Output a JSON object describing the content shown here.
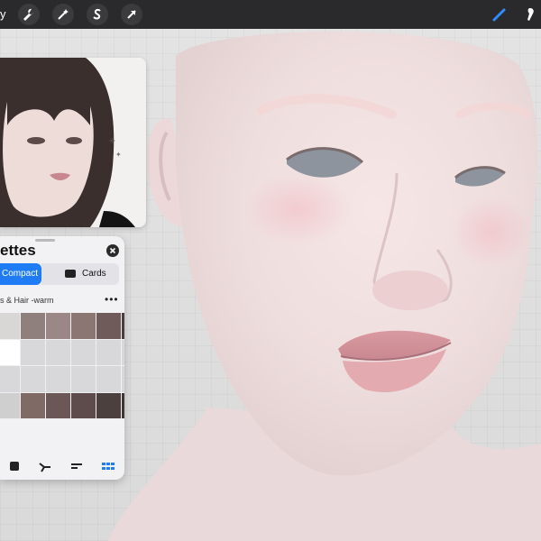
{
  "toolbar": {
    "menu_label": "y",
    "buttons": [
      {
        "name": "wrench-icon"
      },
      {
        "name": "magic-wand-icon"
      },
      {
        "name": "selection-s-icon"
      },
      {
        "name": "transform-arrow-icon"
      }
    ],
    "tools": [
      {
        "name": "brush-icon",
        "color": "#2f8cff"
      },
      {
        "name": "smudge-icon",
        "color": "#ffffff"
      }
    ]
  },
  "palettes": {
    "title": "ettes",
    "tabs": {
      "compact": "Compact",
      "cards": "Cards"
    },
    "palette_name": "s & Hair -warm",
    "swatches": [
      "#d9d7d6",
      "#8f7f7d",
      "#9b8886",
      "#8c7673",
      "#6f5b59",
      "#4a3d3c",
      "#ffffff",
      "#d8d8da",
      "#d8d8da",
      "#d8d8da",
      "#d8d8da",
      "#d8d8da",
      "#d8d8da",
      "#d8d8da",
      "#d8d8da",
      "#d8d8da",
      "#d8d8da",
      "#d8d8da",
      "#d0cfcf",
      "#806a66",
      "#6b5856",
      "#5d4c4b",
      "#4c403f",
      "#3f3534"
    ],
    "accent_color": "#1f7cf5"
  }
}
